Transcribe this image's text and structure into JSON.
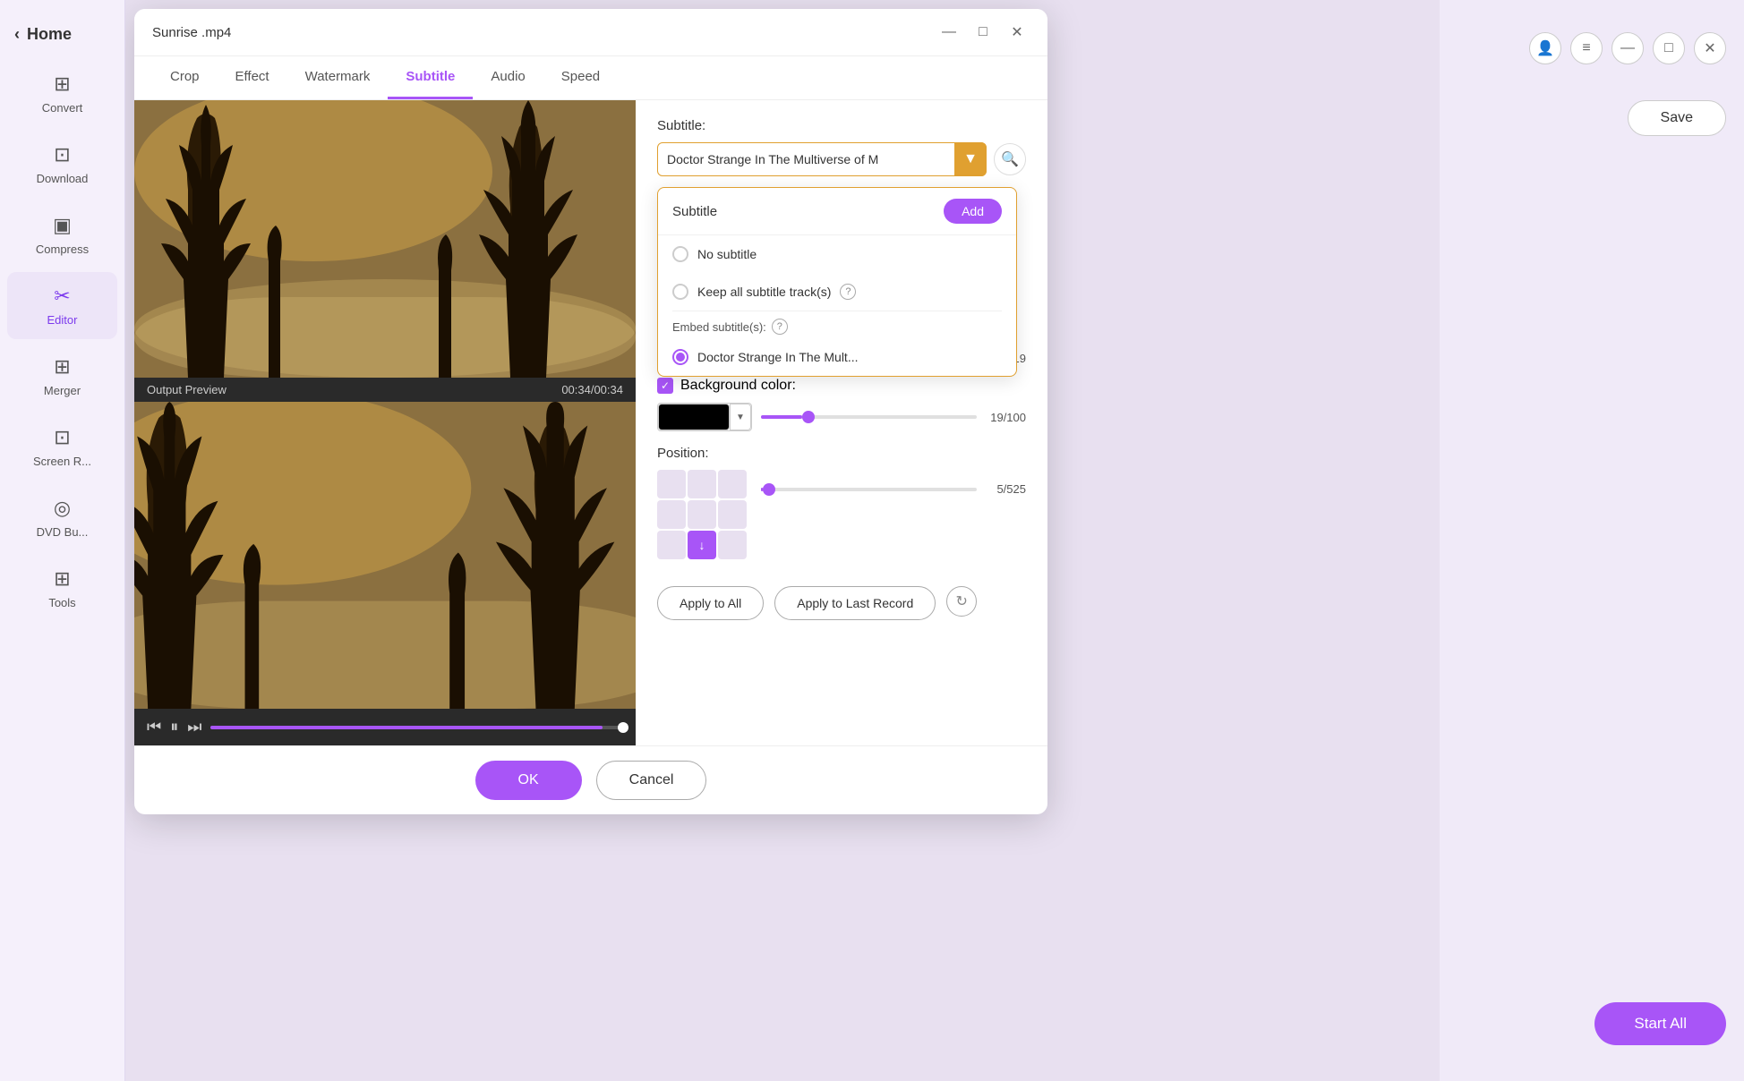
{
  "app": {
    "title": "Sunrise .mp4",
    "close_label": "✕",
    "minimize_label": "—",
    "maximize_label": "□"
  },
  "sidebar": {
    "collapse_icon": "‹",
    "home_label": "Home",
    "items": [
      {
        "id": "convert",
        "label": "Convert",
        "icon": "⊞"
      },
      {
        "id": "download",
        "label": "Download",
        "icon": "⊡"
      },
      {
        "id": "compress",
        "label": "Compress",
        "icon": "▣"
      },
      {
        "id": "editor",
        "label": "Editor",
        "icon": "✂",
        "active": true
      },
      {
        "id": "merger",
        "label": "Merger",
        "icon": "⊞"
      },
      {
        "id": "screen",
        "label": "Screen R...",
        "icon": "⊡"
      },
      {
        "id": "dvd",
        "label": "DVD Bu...",
        "icon": "◎"
      },
      {
        "id": "tools",
        "label": "Tools",
        "icon": "⊞"
      }
    ]
  },
  "tabs": [
    {
      "id": "crop",
      "label": "Crop"
    },
    {
      "id": "effect",
      "label": "Effect"
    },
    {
      "id": "watermark",
      "label": "Watermark"
    },
    {
      "id": "subtitle",
      "label": "Subtitle",
      "active": true
    },
    {
      "id": "audio",
      "label": "Audio"
    },
    {
      "id": "speed",
      "label": "Speed"
    }
  ],
  "video": {
    "output_preview_label": "Output Preview",
    "timecode": "00:34/00:34"
  },
  "subtitle_panel": {
    "label": "Subtitle:",
    "selected_text": "Doctor Strange In The Multiverse of M",
    "search_icon": "🔍",
    "dropdown": {
      "title": "Subtitle",
      "add_button": "Add",
      "options": [
        {
          "id": "no_subtitle",
          "label": "No subtitle",
          "checked": false
        },
        {
          "id": "keep_all",
          "label": "Keep all subtitle track(s)",
          "checked": false,
          "has_help": true
        },
        {
          "id": "embed_label",
          "label": "Embed subtitle(s):",
          "is_section": true,
          "has_help": true
        },
        {
          "id": "doctor_strange",
          "label": "Doctor Strange In The Mult...",
          "checked": true
        }
      ]
    },
    "position_label": "Position:",
    "position_value": "5/525",
    "background_color_label": "Background color:",
    "background_checked": true,
    "color_value": "#000000",
    "opacity_value": "19/100",
    "slider_opacity_percent": 19,
    "slider_position_percent": 1,
    "apply_all_label": "Apply to All",
    "apply_last_label": "Apply to Last Record",
    "ok_label": "OK",
    "cancel_label": "Cancel"
  },
  "right_panel": {
    "save_label": "Save",
    "start_all_label": "Start All"
  }
}
